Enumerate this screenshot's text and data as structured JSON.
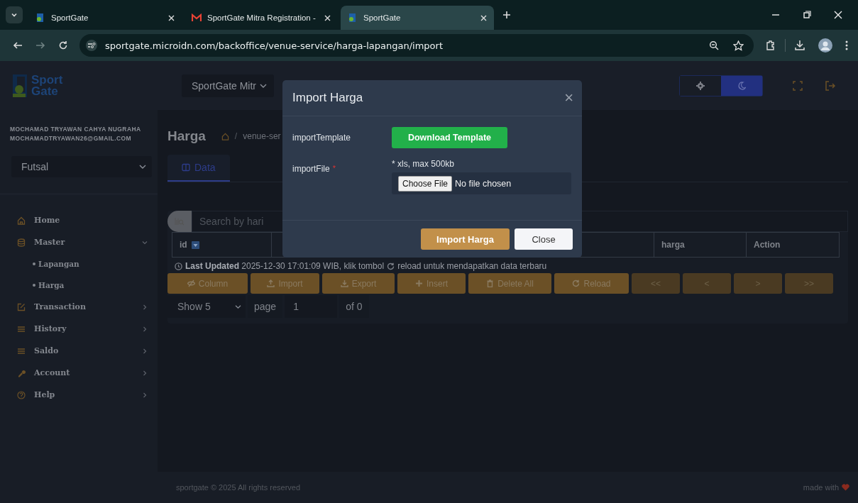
{
  "browser": {
    "tabs": [
      {
        "title": "SportGate",
        "selected": false,
        "kind": "site"
      },
      {
        "title": "SportGate Mitra Registration -",
        "selected": false,
        "kind": "mail"
      },
      {
        "title": "SportGate",
        "selected": true,
        "kind": "site"
      }
    ],
    "url": "sportgate.microidn.com/backoffice/venue-service/harga-lapangan/import"
  },
  "header": {
    "logo": [
      "Sport",
      "Gate"
    ],
    "org_select": "SportGate Mitr",
    "theme": [
      {
        "selected": false
      },
      {
        "selected": true
      }
    ]
  },
  "sidebar": {
    "user_name": "MOCHAMAD TRYAWAN CAHYA NUGRAHA",
    "user_email": "MOCHAMADTRYAWAN26@GMAIL.COM",
    "venue_select": "Futsal",
    "menu": [
      {
        "label": "Home"
      },
      {
        "label": "Master",
        "expanded": true,
        "children": [
          {
            "label": "Lapangan"
          },
          {
            "label": "Harga"
          }
        ]
      },
      {
        "label": "Transaction",
        "expanded": false
      },
      {
        "label": "History",
        "expanded": false
      },
      {
        "label": "Saldo",
        "expanded": false
      },
      {
        "label": "Account",
        "expanded": false
      },
      {
        "label": "Help",
        "expanded": false
      }
    ]
  },
  "page": {
    "title": "Harga",
    "breadcrumb_separator": "/",
    "breadcrumb": "venue-ser",
    "tabs": [
      {
        "label": "Data",
        "selected": true
      }
    ],
    "search": {
      "placeholder": "Search by hari"
    },
    "table": {
      "columns": [
        "id",
        "harga",
        "Action"
      ]
    },
    "last_updated": "**Last Updated** 2025-12-30 17:01:09 WIB, klik tombol",
    "last_updated_tail": "reload untuk mendapatkan data terbaru",
    "toolbar": [
      {
        "label": "Column",
        "disabled": false
      },
      {
        "label": "Import",
        "disabled": false
      },
      {
        "label": "Export",
        "disabled": false
      },
      {
        "label": "Insert",
        "disabled": false
      },
      {
        "label": "Delete All",
        "disabled": false
      },
      {
        "label": "Reload",
        "disabled": false
      },
      {
        "label": "<<",
        "disabled": true
      },
      {
        "label": "<",
        "disabled": true
      },
      {
        "label": ">",
        "disabled": true
      },
      {
        "label": ">>",
        "disabled": true
      }
    ],
    "pager": {
      "show": "Show 5",
      "page_label": "page",
      "page": "1",
      "of": "of 0"
    }
  },
  "footer": {
    "copyright": "sportgate © 2025 All rights reserved",
    "made_with": "made with"
  },
  "modal": {
    "title": "Import Harga",
    "close": "×",
    "template_label": "importTemplate",
    "download_button": "Download Template",
    "file_label": "importFile",
    "required_mark": "*",
    "file_hint": "* xls, max 500kb",
    "choose_button": "Choose File",
    "file_status": "No file chosen",
    "buttons": [
      {
        "label": "Import Harga",
        "kind": "primary"
      },
      {
        "label": "Close",
        "kind": "secondary"
      }
    ]
  }
}
